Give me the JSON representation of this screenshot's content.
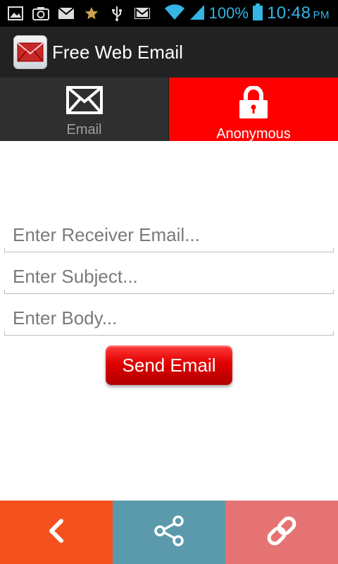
{
  "status_bar": {
    "battery_percent": "100%",
    "time": "10:48",
    "ampm": "PM",
    "icons": [
      "image-icon",
      "camera-icon",
      "mail-icon",
      "star-icon",
      "usb-icon",
      "gmail-icon",
      "wifi-icon",
      "signal-icon",
      "battery-icon"
    ]
  },
  "action_bar": {
    "title": "Free Web Email",
    "app_icon": "envelope-app-icon"
  },
  "tabs": [
    {
      "label": "Email",
      "icon": "envelope-icon",
      "selected": false
    },
    {
      "label": "Anonymous",
      "icon": "lock-icon",
      "selected": true
    }
  ],
  "form": {
    "receiver_placeholder": "Enter Receiver Email...",
    "subject_placeholder": "Enter Subject...",
    "body_placeholder": "Enter Body...",
    "send_label": "Send Email"
  },
  "bottom_bar": {
    "items": [
      "back-icon",
      "share-icon",
      "link-icon"
    ]
  },
  "colors": {
    "anonymous_tab": "#ff0000",
    "send_button": "#e00000",
    "back_button": "#f4511e",
    "share_button": "#5b9aad",
    "link_button": "#e57373",
    "status_text": "#33b5e5"
  }
}
